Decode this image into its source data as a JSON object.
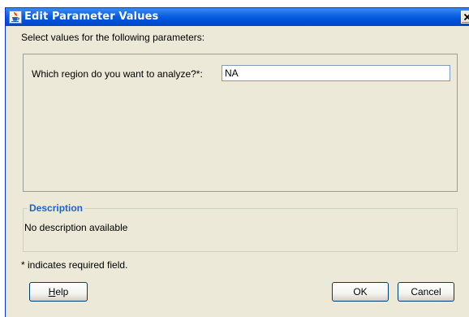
{
  "window": {
    "title": "Edit Parameter Values",
    "icon": "java-cup-icon",
    "close_icon": "close-icon"
  },
  "instruction": "Select values for the following parameters:",
  "parameters": [
    {
      "label": "Which region do you want to analyze?*:",
      "value": "NA"
    }
  ],
  "description": {
    "title": "Description",
    "text": "No description available"
  },
  "required_note": "* indicates required field.",
  "buttons": {
    "help_first": "H",
    "help_rest": "elp",
    "ok": "OK",
    "cancel": "Cancel"
  },
  "colors": {
    "titlebar": "#0a5fe0",
    "dialog_bg": "#ece9d8",
    "description_title": "#2262c6"
  }
}
